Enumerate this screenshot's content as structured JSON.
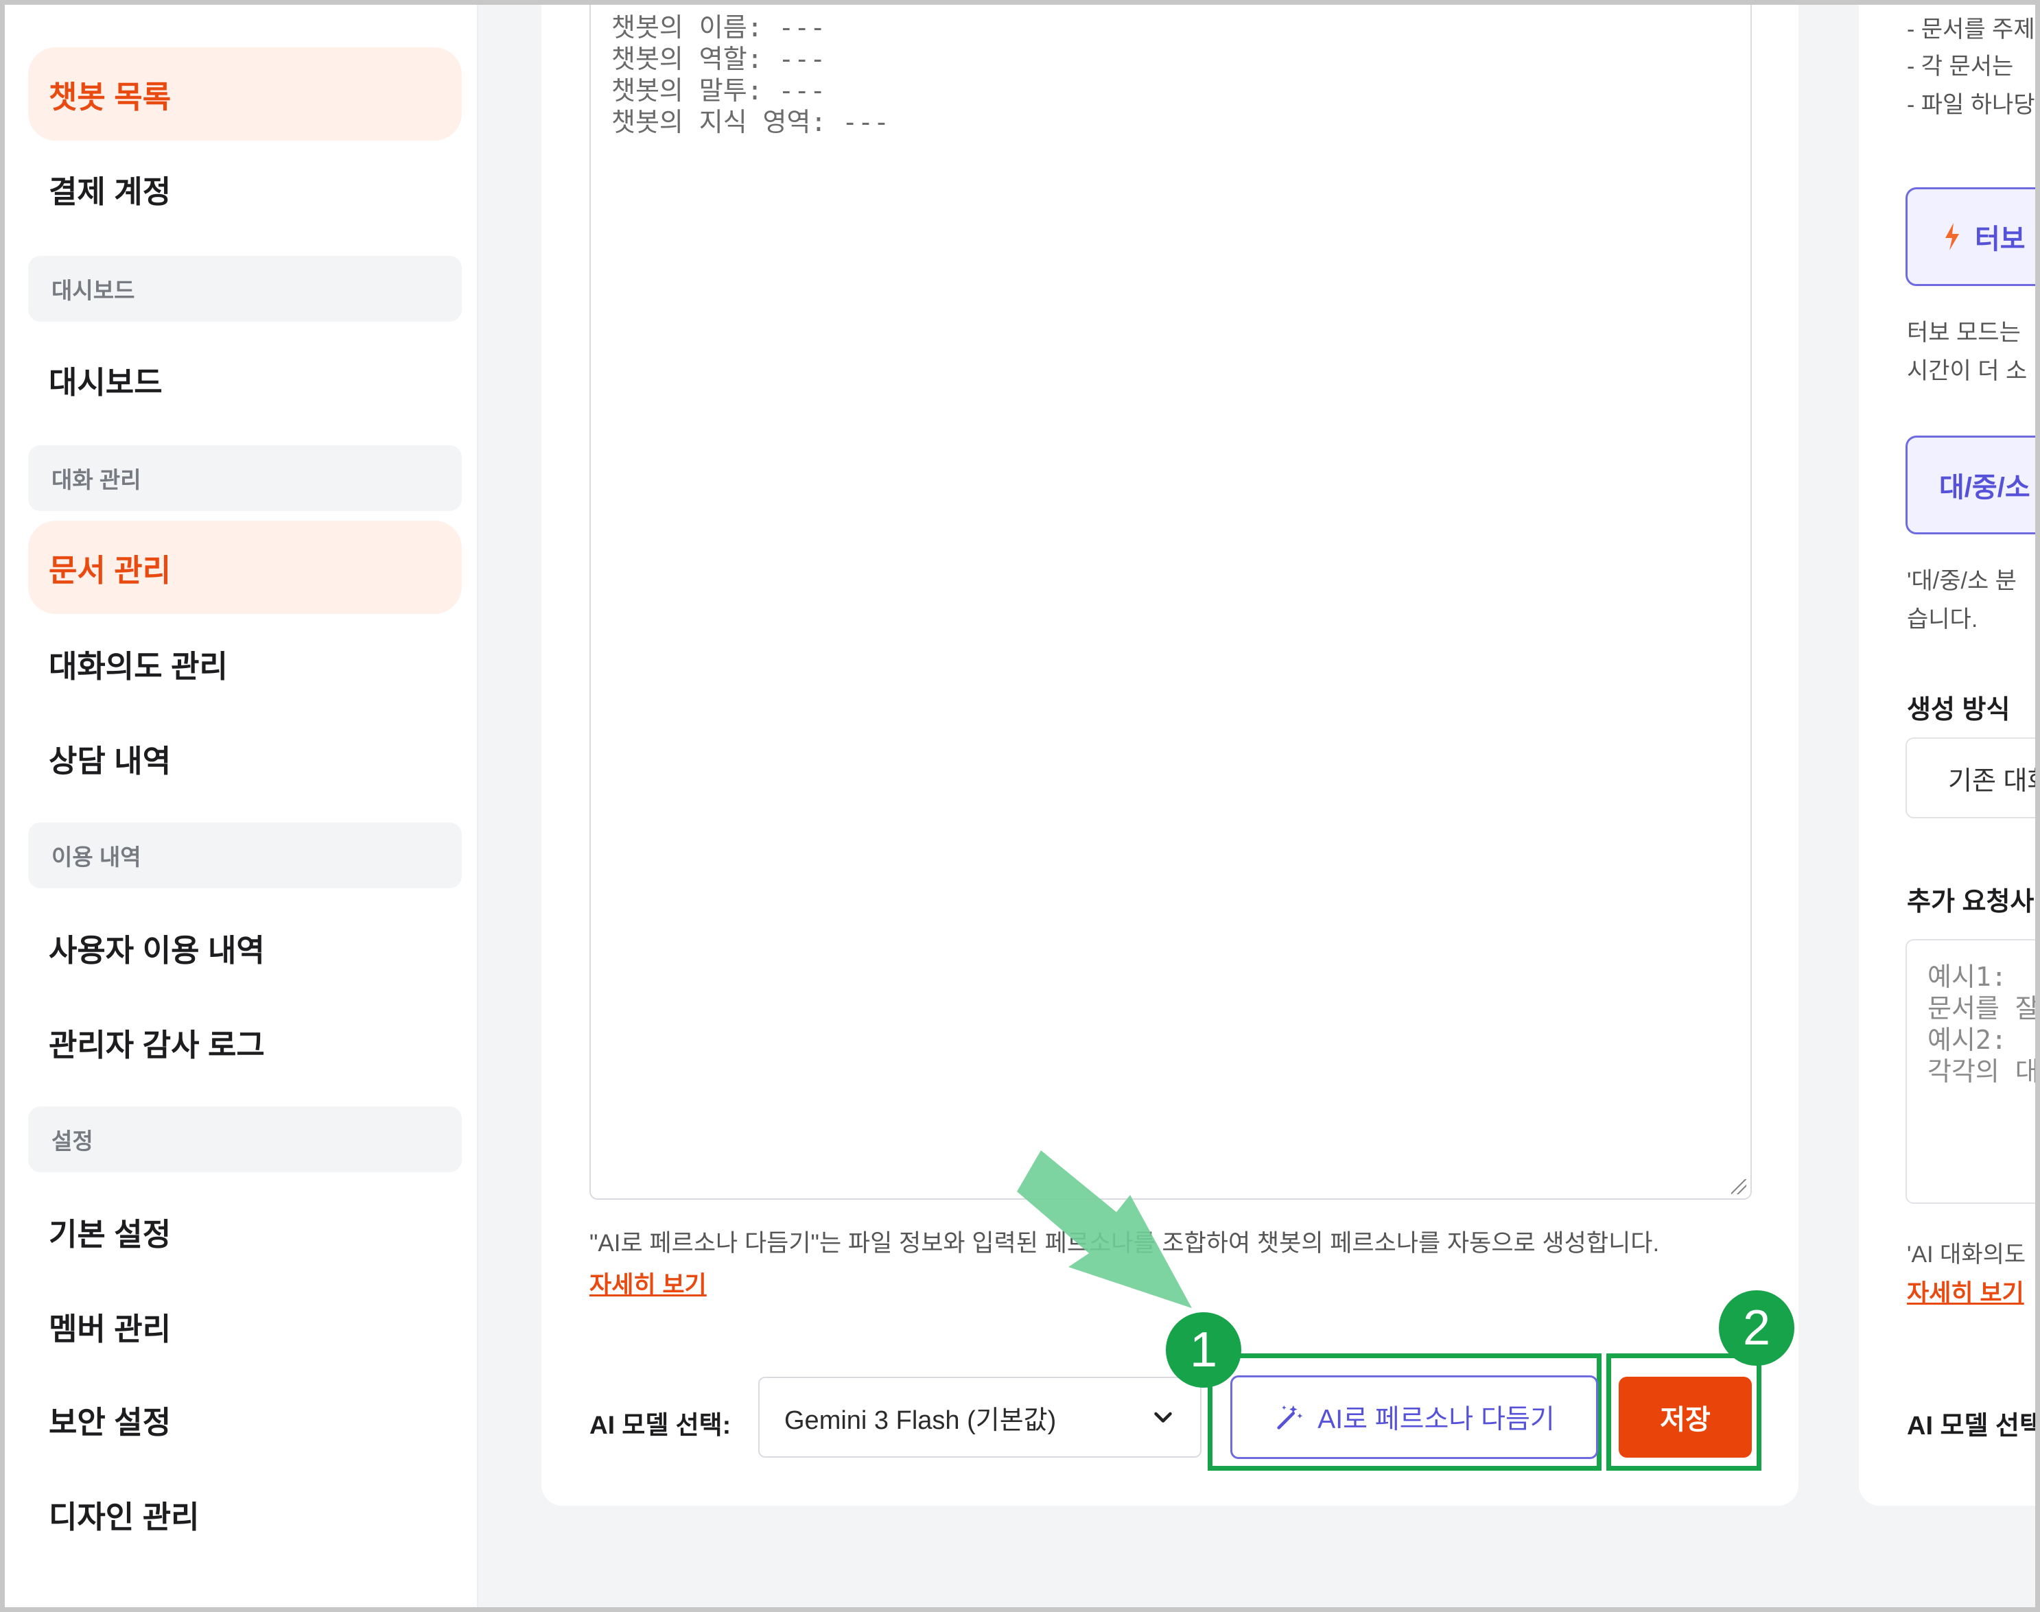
{
  "sidebar": {
    "items": [
      {
        "label": "챗봇 목록",
        "active": true
      },
      {
        "label": "결제 계정"
      },
      {
        "section": "대시보드"
      },
      {
        "label": "대시보드"
      },
      {
        "section": "대화 관리"
      },
      {
        "label": "문서 관리",
        "active": true
      },
      {
        "label": "대화의도 관리"
      },
      {
        "label": "상담 내역"
      },
      {
        "section": "이용 내역"
      },
      {
        "label": "사용자 이용 내역"
      },
      {
        "label": "관리자 감사 로그"
      },
      {
        "section": "설정"
      },
      {
        "label": "기본 설정"
      },
      {
        "label": "멤버 관리"
      },
      {
        "label": "보안 설정"
      },
      {
        "label": "디자인 관리"
      }
    ]
  },
  "main": {
    "persona_lines": [
      "챗봇의 이름: ---",
      "챗봇의 역할: ---",
      "챗봇의 말투: ---",
      "챗봇의 지식 영역: ---"
    ],
    "help_text": "\"AI로 페르소나 다듬기\"는 파일 정보와 입력된 페르소나를 조합하여 챗봇의 페르소나를 자동으로 생성합니다.",
    "more_link": "자세히 보기",
    "model_label": "AI 모델 선택:",
    "model_value": "Gemini 3 Flash (기본값)",
    "ai_button_label": "AI로 페르소나 다듬기",
    "save_label": "저장"
  },
  "annotations": {
    "badge_1": "1",
    "badge_2": "2",
    "highlight_color": "#16a34a",
    "arrow_color": "#6fcf97"
  },
  "right_panel": {
    "bullets": [
      "- 문서를 주제",
      "- 각 문서는 ",
      "- 파일 하나당"
    ],
    "turbo_button": "터보",
    "turbo_desc_1": "터보 모드는",
    "turbo_desc_2": "시간이 더 소",
    "category_button": "대/중/소",
    "category_desc_1": "'대/중/소 분",
    "category_desc_2": "습니다.",
    "generation_heading": "생성 방식",
    "generation_value": "기존 대화",
    "extra_heading": "추가 요청사",
    "extra_placeholder_lines": [
      "예시1:",
      "문서를 잘",
      "예시2:",
      "각각의 대"
    ],
    "ai_intent_text": "'AI 대화의도",
    "more_link": "자세히 보기",
    "model_label": "AI 모델 선택"
  },
  "colors": {
    "accent_orange": "#e9450b",
    "accent_purple": "#5552d9",
    "active_bg": "#fff0ea"
  }
}
